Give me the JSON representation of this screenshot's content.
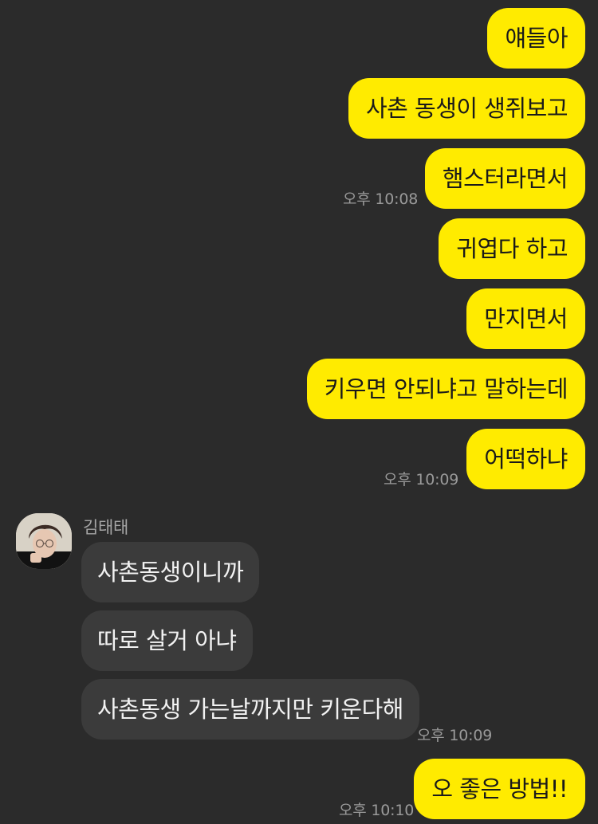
{
  "sender": {
    "name": "김태태"
  },
  "messages": {
    "m1": "얘들아",
    "m2": "사촌 동생이 생쥐보고",
    "m3": "햄스터라면서",
    "t1": "오후 10:08",
    "m4": "귀엽다 하고",
    "m5": "만지면서",
    "m6": "키우면 안되냐고 말하는데",
    "m7": "어떡하냐",
    "t2": "오후 10:09",
    "r1": "사촌동생이니까",
    "r2": "따로 살거 아냐",
    "r3": "사촌동생 가는날까지만 키운다해",
    "t3": "오후 10:09",
    "m8": "오 좋은 방법!!",
    "t4": "오후 10:10"
  },
  "colors": {
    "background": "#2b2b2b",
    "my_bubble": "#ffeb00",
    "their_bubble": "#3b3b3b"
  }
}
